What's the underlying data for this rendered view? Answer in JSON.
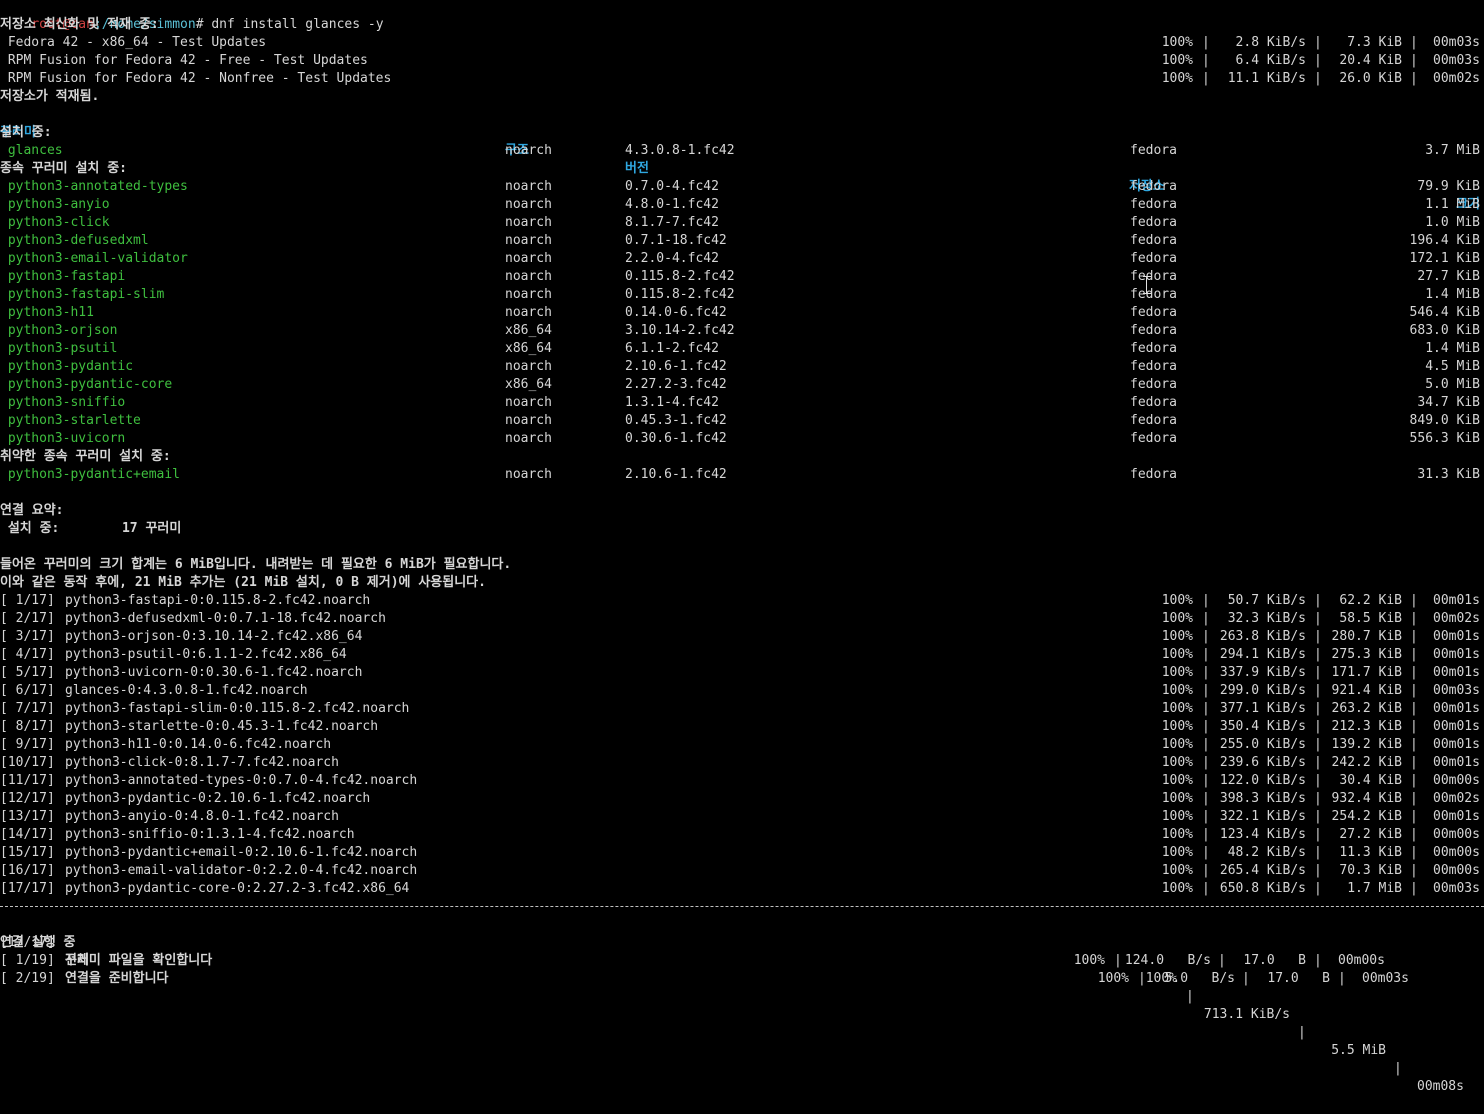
{
  "prompt": {
    "user": "root",
    "host": "can",
    "path": ":/home/simmon",
    "command": "# dnf install glances -y"
  },
  "repo_update_title": "저장소 최신화 및 적재 중:",
  "repo_rows": [
    {
      "name": " Fedora 42 - x86_64 - Test Updates",
      "pct": "100%",
      "speed": "2.8 KiB/s",
      "size": "7.3 KiB",
      "time": "00m03s"
    },
    {
      "name": " RPM Fusion for Fedora 42 - Free - Test Updates",
      "pct": "100%",
      "speed": "6.4 KiB/s",
      "size": "20.4 KiB",
      "time": "00m03s"
    },
    {
      "name": " RPM Fusion for Fedora 42 - Nonfree - Test Updates",
      "pct": "100%",
      "speed": "11.1 KiB/s",
      "size": "26.0 KiB",
      "time": "00m02s"
    }
  ],
  "repo_loaded": "저장소가 적재됨.",
  "table_header": {
    "package": "꾸러미",
    "arch": "구조",
    "version": "버전",
    "repo": "저장소",
    "size": "크기"
  },
  "installing_label": "설치 중:",
  "installing": [
    {
      "name": " glances",
      "arch": "noarch",
      "version": "4.3.0.8-1.fc42",
      "repo": "fedora",
      "size": "3.7 MiB"
    }
  ],
  "deps_label": "종속 꾸러미 설치 중:",
  "deps": [
    {
      "name": " python3-annotated-types",
      "arch": "noarch",
      "version": "0.7.0-4.fc42",
      "repo": "fedora",
      "size": "79.9 KiB"
    },
    {
      "name": " python3-anyio",
      "arch": "noarch",
      "version": "4.8.0-1.fc42",
      "repo": "fedora",
      "size": "1.1 MiB"
    },
    {
      "name": " python3-click",
      "arch": "noarch",
      "version": "8.1.7-7.fc42",
      "repo": "fedora",
      "size": "1.0 MiB"
    },
    {
      "name": " python3-defusedxml",
      "arch": "noarch",
      "version": "0.7.1-18.fc42",
      "repo": "fedora",
      "size": "196.4 KiB"
    },
    {
      "name": " python3-email-validator",
      "arch": "noarch",
      "version": "2.2.0-4.fc42",
      "repo": "fedora",
      "size": "172.1 KiB"
    },
    {
      "name": " python3-fastapi",
      "arch": "noarch",
      "version": "0.115.8-2.fc42",
      "repo": "fedora",
      "size": "27.7 KiB"
    },
    {
      "name": " python3-fastapi-slim",
      "arch": "noarch",
      "version": "0.115.8-2.fc42",
      "repo": "fedora",
      "size": "1.4 MiB"
    },
    {
      "name": " python3-h11",
      "arch": "noarch",
      "version": "0.14.0-6.fc42",
      "repo": "fedora",
      "size": "546.4 KiB"
    },
    {
      "name": " python3-orjson",
      "arch": "x86_64",
      "version": "3.10.14-2.fc42",
      "repo": "fedora",
      "size": "683.0 KiB"
    },
    {
      "name": " python3-psutil",
      "arch": "x86_64",
      "version": "6.1.1-2.fc42",
      "repo": "fedora",
      "size": "1.4 MiB"
    },
    {
      "name": " python3-pydantic",
      "arch": "noarch",
      "version": "2.10.6-1.fc42",
      "repo": "fedora",
      "size": "4.5 MiB"
    },
    {
      "name": " python3-pydantic-core",
      "arch": "x86_64",
      "version": "2.27.2-3.fc42",
      "repo": "fedora",
      "size": "5.0 MiB"
    },
    {
      "name": " python3-sniffio",
      "arch": "noarch",
      "version": "1.3.1-4.fc42",
      "repo": "fedora",
      "size": "34.7 KiB"
    },
    {
      "name": " python3-starlette",
      "arch": "noarch",
      "version": "0.45.3-1.fc42",
      "repo": "fedora",
      "size": "849.0 KiB"
    },
    {
      "name": " python3-uvicorn",
      "arch": "noarch",
      "version": "0.30.6-1.fc42",
      "repo": "fedora",
      "size": "556.3 KiB"
    }
  ],
  "weak_label": "취약한 종속 꾸러미 설치 중:",
  "weak": [
    {
      "name": " python3-pydantic+email",
      "arch": "noarch",
      "version": "2.10.6-1.fc42",
      "repo": "fedora",
      "size": "31.3 KiB"
    }
  ],
  "summary_label": "연결 요약:",
  "summary_install": " 설치 중:        17 꾸러미",
  "total_size_msg": "들어온 꾸러미의 크기 합계는 6 MiB입니다. 내려받는 데 필요한 6 MiB가 필요합니다.",
  "after_msg": "이와 같은 동작 후에, 21 MiB 추가는 (21 MiB 설치, 0 B 제거)에 사용됩니다.",
  "downloads": [
    {
      "idx": "[ 1/17]",
      "file": "python3-fastapi-0:0.115.8-2.fc42.noarch",
      "pct": "100%",
      "speed": "50.7 KiB/s",
      "size": "62.2 KiB",
      "time": "00m01s"
    },
    {
      "idx": "[ 2/17]",
      "file": "python3-defusedxml-0:0.7.1-18.fc42.noarch",
      "pct": "100%",
      "speed": "32.3 KiB/s",
      "size": "58.5 KiB",
      "time": "00m02s"
    },
    {
      "idx": "[ 3/17]",
      "file": "python3-orjson-0:3.10.14-2.fc42.x86_64",
      "pct": "100%",
      "speed": "263.8 KiB/s",
      "size": "280.7 KiB",
      "time": "00m01s"
    },
    {
      "idx": "[ 4/17]",
      "file": "python3-psutil-0:6.1.1-2.fc42.x86_64",
      "pct": "100%",
      "speed": "294.1 KiB/s",
      "size": "275.3 KiB",
      "time": "00m01s"
    },
    {
      "idx": "[ 5/17]",
      "file": "python3-uvicorn-0:0.30.6-1.fc42.noarch",
      "pct": "100%",
      "speed": "337.9 KiB/s",
      "size": "171.7 KiB",
      "time": "00m01s"
    },
    {
      "idx": "[ 6/17]",
      "file": "glances-0:4.3.0.8-1.fc42.noarch",
      "pct": "100%",
      "speed": "299.0 KiB/s",
      "size": "921.4 KiB",
      "time": "00m03s"
    },
    {
      "idx": "[ 7/17]",
      "file": "python3-fastapi-slim-0:0.115.8-2.fc42.noarch",
      "pct": "100%",
      "speed": "377.1 KiB/s",
      "size": "263.2 KiB",
      "time": "00m01s"
    },
    {
      "idx": "[ 8/17]",
      "file": "python3-starlette-0:0.45.3-1.fc42.noarch",
      "pct": "100%",
      "speed": "350.4 KiB/s",
      "size": "212.3 KiB",
      "time": "00m01s"
    },
    {
      "idx": "[ 9/17]",
      "file": "python3-h11-0:0.14.0-6.fc42.noarch",
      "pct": "100%",
      "speed": "255.0 KiB/s",
      "size": "139.2 KiB",
      "time": "00m01s"
    },
    {
      "idx": "[10/17]",
      "file": "python3-click-0:8.1.7-7.fc42.noarch",
      "pct": "100%",
      "speed": "239.6 KiB/s",
      "size": "242.2 KiB",
      "time": "00m01s"
    },
    {
      "idx": "[11/17]",
      "file": "python3-annotated-types-0:0.7.0-4.fc42.noarch",
      "pct": "100%",
      "speed": "122.0 KiB/s",
      "size": "30.4 KiB",
      "time": "00m00s"
    },
    {
      "idx": "[12/17]",
      "file": "python3-pydantic-0:2.10.6-1.fc42.noarch",
      "pct": "100%",
      "speed": "398.3 KiB/s",
      "size": "932.4 KiB",
      "time": "00m02s"
    },
    {
      "idx": "[13/17]",
      "file": "python3-anyio-0:4.8.0-1.fc42.noarch",
      "pct": "100%",
      "speed": "322.1 KiB/s",
      "size": "254.2 KiB",
      "time": "00m01s"
    },
    {
      "idx": "[14/17]",
      "file": "python3-sniffio-0:1.3.1-4.fc42.noarch",
      "pct": "100%",
      "speed": "123.4 KiB/s",
      "size": "27.2 KiB",
      "time": "00m00s"
    },
    {
      "idx": "[15/17]",
      "file": "python3-pydantic+email-0:2.10.6-1.fc42.noarch",
      "pct": "100%",
      "speed": "48.2 KiB/s",
      "size": "11.3 KiB",
      "time": "00m00s"
    },
    {
      "idx": "[16/17]",
      "file": "python3-email-validator-0:2.2.0-4.fc42.noarch",
      "pct": "100%",
      "speed": "265.4 KiB/s",
      "size": "70.3 KiB",
      "time": "00m00s"
    },
    {
      "idx": "[17/17]",
      "file": "python3-pydantic-core-0:2.27.2-3.fc42.x86_64",
      "pct": "100%",
      "speed": "650.8 KiB/s",
      "size": "1.7 MiB",
      "time": "00m03s"
    }
  ],
  "total": {
    "idx": "[17/17]",
    "label": "전체",
    "pct": "100%",
    "speed": "713.1 KiB/s",
    "size": "5.5 MiB",
    "time": "00m08s"
  },
  "run_label": "연결 실행 중",
  "steps": [
    {
      "idx": "[ 1/19]",
      "label": "꾸러미 파일을 확인합니다",
      "pct": "100%",
      "speed": "124.0   B/s",
      "size": "17.0   B",
      "time": "00m00s"
    },
    {
      "idx": "[ 2/19]",
      "label": "연결을 준비합니다",
      "pct": "100%",
      "speed": "5.0   B/s",
      "size": "17.0   B",
      "time": "00m03s"
    }
  ]
}
